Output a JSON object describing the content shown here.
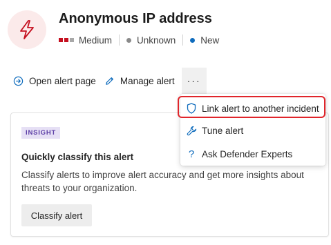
{
  "header": {
    "title": "Anonymous IP address",
    "severity": {
      "label": "Medium",
      "bar_colors": [
        "#c50f1f",
        "#c50f1f",
        "#a8a8a8"
      ]
    },
    "status_unknown": {
      "label": "Unknown",
      "dot_color": "#8a8a8a"
    },
    "status_new": {
      "label": "New",
      "dot_color": "#0f6cbd"
    },
    "icon": "lightning-bolt-icon",
    "icon_color": "#c50f1f"
  },
  "actions": {
    "open_alert_page": "Open alert page",
    "manage_alert": "Manage alert",
    "more": "···"
  },
  "menu": {
    "items": [
      {
        "label": "Link alert to another incident",
        "icon": "shield-icon"
      },
      {
        "label": "Tune alert",
        "icon": "wrench-icon"
      },
      {
        "label": "Ask Defender Experts",
        "icon": "question-icon"
      }
    ],
    "highlight_color": "#e0252b"
  },
  "insight": {
    "badge": "INSIGHT",
    "title": "Quickly classify this alert",
    "body": "Classify alerts to improve alert accuracy and get more insights about threats to your organization.",
    "button": "Classify alert"
  }
}
